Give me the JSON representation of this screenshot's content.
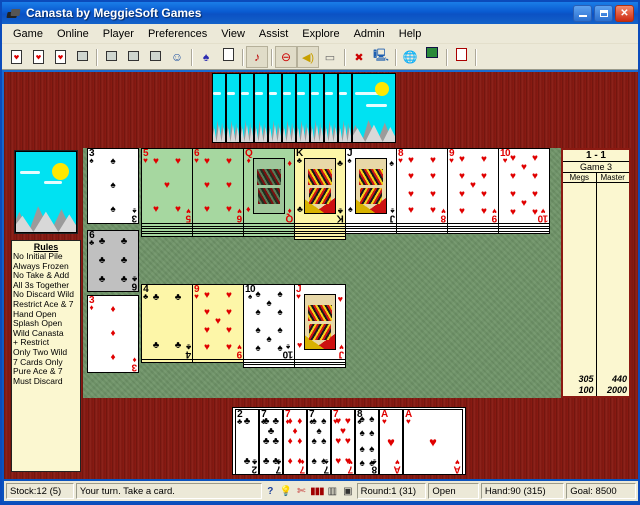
{
  "window": {
    "title": "Canasta by MeggieSoft Games",
    "icon": "cards-icon",
    "controls": {
      "minimize": "_",
      "maximize": "□",
      "close": "✕"
    }
  },
  "menu": {
    "items": [
      "Game",
      "Online",
      "Player",
      "Preferences",
      "View",
      "Assist",
      "Explore",
      "Admin",
      "Help"
    ]
  },
  "toolbar": {
    "buttons": [
      {
        "name": "new-game-icon",
        "glyph": "card"
      },
      {
        "name": "open-game-icon",
        "glyph": "card"
      },
      {
        "name": "save-game-icon",
        "glyph": "card"
      },
      {
        "name": "connect-history-icon",
        "glyph": "monitor"
      },
      {
        "name": "connect-network-icon",
        "glyph": "monitor"
      },
      {
        "name": "connect-help-icon",
        "glyph": "monitor"
      },
      {
        "name": "disconnect-icon",
        "glyph": "monitor"
      },
      {
        "name": "player-profile-icon",
        "glyph": "person"
      },
      {
        "name": "hint-genie-icon",
        "glyph": "genie"
      },
      {
        "name": "scorepad-icon",
        "glyph": "clipboard"
      },
      {
        "name": "music-toggle-icon",
        "glyph": "note"
      },
      {
        "name": "sound-mute-icon",
        "glyph": "mute"
      },
      {
        "name": "sound-volume-icon",
        "glyph": "speaker"
      },
      {
        "name": "chat-icon",
        "glyph": "chat"
      },
      {
        "name": "chat-off-icon",
        "glyph": "chatoff"
      },
      {
        "name": "internet-connect-icon",
        "glyph": "pcweb"
      },
      {
        "name": "globe-icon",
        "glyph": "globe"
      },
      {
        "name": "rulebook-icon",
        "glyph": "book"
      },
      {
        "name": "exit-icon",
        "glyph": "exit"
      }
    ]
  },
  "rules_panel": {
    "title": "Rules",
    "items": [
      "No Initial Pile",
      "Always Frozen",
      "No Take & Add",
      "All 3s Together",
      "No Discard Wild",
      "Restrict Ace & 7",
      "Hand Open",
      "Splash Open",
      "Wild Canasta",
      " + Restrict",
      "Only Two Wild",
      "7 Cards Only",
      "Pure Ace & 7",
      "Must Discard"
    ]
  },
  "scoreboard": {
    "match": "1 - 1",
    "game": "Game  3",
    "players": [
      "Megs",
      "Master"
    ],
    "totals": [
      "305",
      "440"
    ],
    "subtotals": [
      "100",
      "2000"
    ]
  },
  "statusbar": {
    "stock": "Stock:12 (5)",
    "message": "Your turn.  Take a card.",
    "icons": [
      "help-icon",
      "hint-icon",
      "no-chat-icon",
      "cards-icon",
      "sort-icon",
      "box-icon"
    ],
    "round": "Round:1 (31)",
    "open": "Open",
    "hand": "Hand:90 (315)",
    "goal": "Goal: 8500"
  },
  "table": {
    "opponent_hand_count": 11,
    "left_stacks": [
      {
        "name": "three-spades-pile",
        "rank": "3",
        "suit": "♠",
        "color": "blk",
        "style": "white",
        "count": 1
      },
      {
        "name": "six-clubs-pile",
        "rank": "6",
        "suit": "♣",
        "color": "blk",
        "style": "grey",
        "count": 1
      },
      {
        "name": "three-diamonds-pile",
        "rank": "3",
        "suit": "♦",
        "color": "red",
        "style": "white",
        "count": 1
      }
    ],
    "melds_top": [
      {
        "name": "meld-five-hearts",
        "rank": "5",
        "suit": "♥",
        "color": "red",
        "style": "green",
        "stack": 5
      },
      {
        "name": "meld-six-hearts",
        "rank": "6",
        "suit": "♥",
        "color": "red",
        "style": "green",
        "stack": 5
      },
      {
        "name": "meld-queen-diamonds",
        "rank": "Q",
        "suit": "♦",
        "color": "red",
        "style": "green",
        "stack": 5,
        "face": true
      },
      {
        "name": "meld-king-clubs",
        "rank": "K",
        "suit": "♣",
        "color": "blk",
        "style": "yellow",
        "stack": 6,
        "face": true
      },
      {
        "name": "meld-jack-spades",
        "rank": "J",
        "suit": "♠",
        "color": "blk",
        "style": "white",
        "stack": 4,
        "face": true
      },
      {
        "name": "meld-eight-hearts",
        "rank": "8",
        "suit": "♥",
        "color": "red",
        "style": "white",
        "stack": 4
      },
      {
        "name": "meld-nine-hearts",
        "rank": "9",
        "suit": "♥",
        "color": "red",
        "style": "white",
        "stack": 4
      },
      {
        "name": "meld-ten-hearts",
        "rank": "10",
        "suit": "♥",
        "color": "red",
        "style": "white",
        "stack": 4
      }
    ],
    "melds_bottom": [
      {
        "name": "meld-four-clubs",
        "rank": "4",
        "suit": "♣",
        "color": "blk",
        "style": "yellow",
        "stack": 1
      },
      {
        "name": "meld-nine-hearts-2",
        "rank": "9",
        "suit": "♥",
        "color": "red",
        "style": "yellow",
        "stack": 1
      },
      {
        "name": "meld-ten-spades",
        "rank": "10",
        "suit": "♠",
        "color": "blk",
        "style": "white",
        "stack": 3
      },
      {
        "name": "meld-jack-hearts",
        "rank": "J",
        "suit": "♥",
        "color": "red",
        "style": "white",
        "stack": 3,
        "face": true
      }
    ],
    "player_hand": [
      {
        "name": "hand-card-2c",
        "rank": "2",
        "suit": "♣",
        "color": "blk"
      },
      {
        "name": "hand-card-7c",
        "rank": "7",
        "suit": "♣",
        "color": "blk"
      },
      {
        "name": "hand-card-7d",
        "rank": "7",
        "suit": "♦",
        "color": "red"
      },
      {
        "name": "hand-card-7s",
        "rank": "7",
        "suit": "♠",
        "color": "blk"
      },
      {
        "name": "hand-card-7h",
        "rank": "7",
        "suit": "♥",
        "color": "red"
      },
      {
        "name": "hand-card-8s",
        "rank": "8",
        "suit": "♠",
        "color": "blk"
      },
      {
        "name": "hand-card-ah1",
        "rank": "A",
        "suit": "♥",
        "color": "red"
      },
      {
        "name": "hand-card-ah2",
        "rank": "A",
        "suit": "♥",
        "color": "red"
      }
    ]
  },
  "colors": {
    "felt": "#6f9468",
    "table_wood": "#8b1a12",
    "panel": "#fbf7d0",
    "chrome": "#ece9d8",
    "titlebar": "#0a5ad0",
    "red_suit": "#e00000"
  }
}
